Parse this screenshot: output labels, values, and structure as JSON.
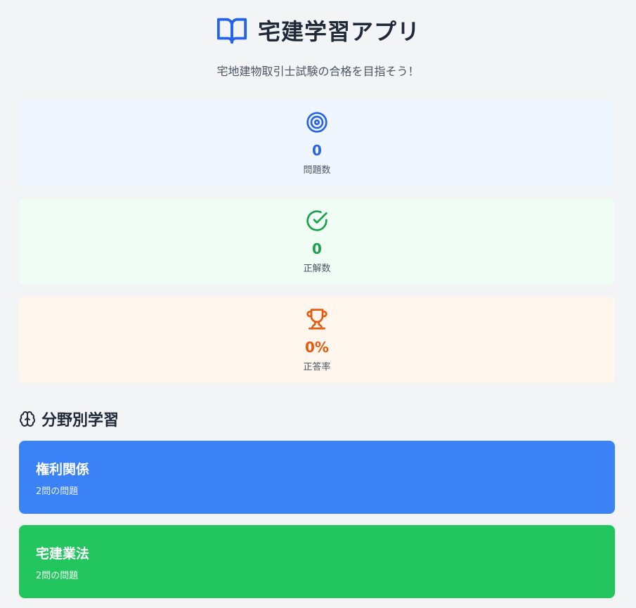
{
  "header": {
    "icon": "book-open-icon",
    "title": "宅建学習アプリ",
    "subtitle": "宅地建物取引士試験の合格を目指そう！",
    "accent_color": "#2563eb"
  },
  "stats": [
    {
      "icon": "target-icon",
      "value": "0",
      "label": "問題数",
      "color": "#2563eb",
      "background": "#eff6ff"
    },
    {
      "icon": "check-circle-icon",
      "value": "0",
      "label": "正解数",
      "color": "#16a34a",
      "background": "#f0fdf4"
    },
    {
      "icon": "trophy-icon",
      "value": "0%",
      "label": "正答率",
      "color": "#ea580c",
      "background": "#fff7ed"
    }
  ],
  "section": {
    "icon": "brain-icon",
    "title": "分野別学習"
  },
  "categories": [
    {
      "name": "権利関係",
      "count": "2問の問題",
      "color": "#3b82f6"
    },
    {
      "name": "宅建業法",
      "count": "2問の問題",
      "color": "#22c55e"
    }
  ]
}
